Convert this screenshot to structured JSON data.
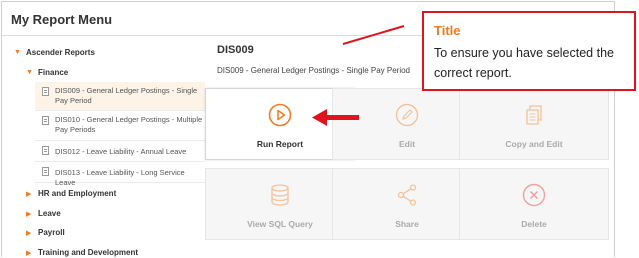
{
  "header": {
    "title": "My Report Menu"
  },
  "tree": {
    "root": "Ascender Reports",
    "finance": "Finance",
    "leaves": [
      {
        "label": "DIS009 - General Ledger Postings - Single Pay Period",
        "selected": true
      },
      {
        "label": "DIS010 - General Ledger Postings - Multiple Pay Periods",
        "selected": false
      },
      {
        "label": "DIS012 - Leave Liability - Annual Leave",
        "selected": false
      },
      {
        "label": "DIS013 - Leave Liability - Long Service Leave",
        "selected": false
      }
    ],
    "groups": [
      "HR and Employment",
      "Leave",
      "Payroll",
      "Training and Development"
    ]
  },
  "report": {
    "code": "DIS009",
    "description": "DIS009 - General Ledger Postings - Single Pay Period"
  },
  "actions": [
    {
      "label": "Run Report",
      "icon": "play-circle-icon",
      "active": true
    },
    {
      "label": "Edit",
      "icon": "pencil-circle-icon",
      "active": false
    },
    {
      "label": "Copy and Edit",
      "icon": "copy-documents-icon",
      "active": false
    },
    {
      "label": "View SQL Query",
      "icon": "database-icon",
      "active": false
    },
    {
      "label": "Share",
      "icon": "share-icon",
      "active": false
    },
    {
      "label": "Delete",
      "icon": "delete-circle-icon",
      "active": false
    }
  ],
  "callout": {
    "title": "Title",
    "body": "To ensure you have selected the correct report."
  },
  "colors": {
    "accent": "#f07a22",
    "annotation": "#e0141c",
    "selected_bg": "#fdf3e6"
  }
}
